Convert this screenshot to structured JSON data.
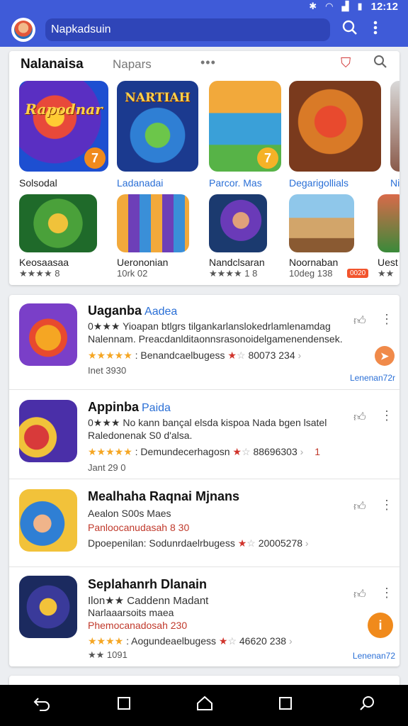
{
  "status": {
    "time": "12:12",
    "icons": [
      "bluetooth-icon",
      "wifi-icon",
      "signal-icon",
      "battery-icon"
    ]
  },
  "appbar": {
    "search_text": "Napkadsuin",
    "accent": "#3f5bd8"
  },
  "featured": {
    "tab_main": "Nalanaisa",
    "tab_second": "Napars",
    "tab_more": "•••",
    "row1": [
      {
        "name": "Solsodal",
        "logo": "Rapodnar",
        "badge": "7"
      },
      {
        "name": "Ladanadai",
        "logo": "NARTIAH"
      },
      {
        "name": "Parcor. Mas",
        "badge": "7"
      },
      {
        "name": "Degarigollials"
      },
      {
        "name": "Nipa"
      }
    ],
    "row2": [
      {
        "name": "Keosaasaa",
        "rating": "★★★★ 8"
      },
      {
        "name": "Uerononian",
        "rating": "10rk 02"
      },
      {
        "name": "Nandclsaran",
        "rating": "★★★★ 1 8"
      },
      {
        "name": "Noornaban",
        "rating": "10deg 138",
        "tag": "0020"
      },
      {
        "name": "Uest",
        "rating": "★★"
      }
    ]
  },
  "apps": [
    {
      "title": "Uaganba",
      "sub": "Aadea",
      "line1": "0★★★ Yioapan btlgrs tilgankarlanslokedrlamlenamdag",
      "line2": "Nalennam. Preacdanlditaonnsrasonoidelgamenendensek.",
      "rating_stars": "★★★★★",
      "rating_text": ": Benandcaelbugess",
      "rating_num": "80073 234",
      "footer": "Inet 3930",
      "link": "Lenenan72r"
    },
    {
      "title": "Appinba",
      "sub": "Paida",
      "line1": "0★★★ No kann bançal elsda kispoa Nada bgen lsatel",
      "line2": "Raledonenak S0 d'alsa.",
      "rating_stars": "★★★★★",
      "rating_text": ": Demundecerhagosn",
      "rating_num": "88696303",
      "rating_extra": "1",
      "footer": "Jant 29 0"
    },
    {
      "title": "Mealhaha Raqnai Mjnans",
      "line1": "Aealon S00s Maes",
      "line2": "Panloocanudasah 8 30",
      "rating_text": "Dpoepenilan: Sodunrdaelrbugess",
      "rating_num": "20005278"
    },
    {
      "title": "Seplahanrh Dlanain",
      "line1": "Ilon★★ Caddenn Madant",
      "line2": "Narlaaarsoits maea",
      "line3": "Phemocanadosah 230",
      "rating_stars": "★★★★",
      "rating_text": ": Aogundeaelbugess",
      "rating_num": "46620 238",
      "footer": "★★ 1091",
      "link": "Lenenan72"
    }
  ],
  "navbar": {
    "icons": [
      "back-icon",
      "recents-icon",
      "home-icon",
      "overview-icon",
      "search-icon"
    ]
  }
}
